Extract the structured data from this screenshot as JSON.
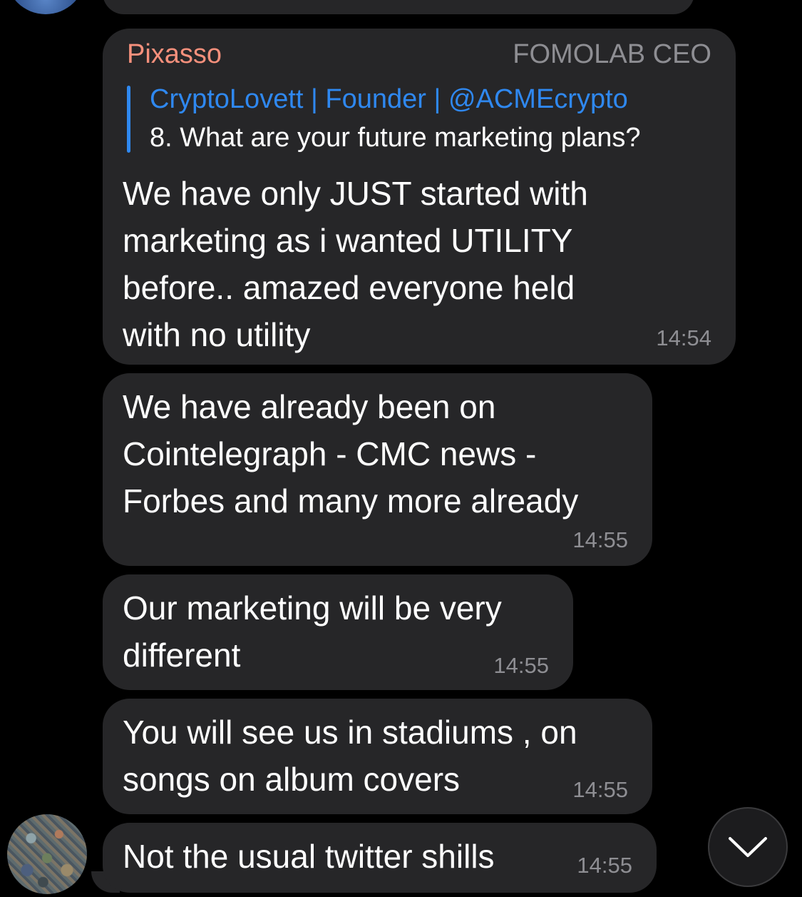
{
  "chat": {
    "reply_message": {
      "sender": "Pixasso",
      "sender_color": "#f6907c",
      "role": "FOMOLAB CEO",
      "quote": {
        "author": "CryptoLovett | Founder | @ACMEcrypto",
        "author_color": "#2f88f0",
        "text": "8. What are your future marketing plans?"
      },
      "text": "We have only JUST started with\nmarketing as i wanted UTILITY\nbefore.. amazed everyone held\nwith no utility",
      "time": "14:54"
    },
    "messages": [
      {
        "text": "We have already been on\nCointelegraph - CMC news -\nForbes and many more already",
        "time": "14:55"
      },
      {
        "text": "Our marketing will be very\ndifferent",
        "time": "14:55"
      },
      {
        "text": "You will see us in stadiums , on\nsongs on album covers",
        "time": "14:55"
      },
      {
        "text": "Not the usual twitter shills",
        "time": "14:55"
      }
    ]
  },
  "icons": {
    "scroll_down": "chevron-down-icon"
  }
}
